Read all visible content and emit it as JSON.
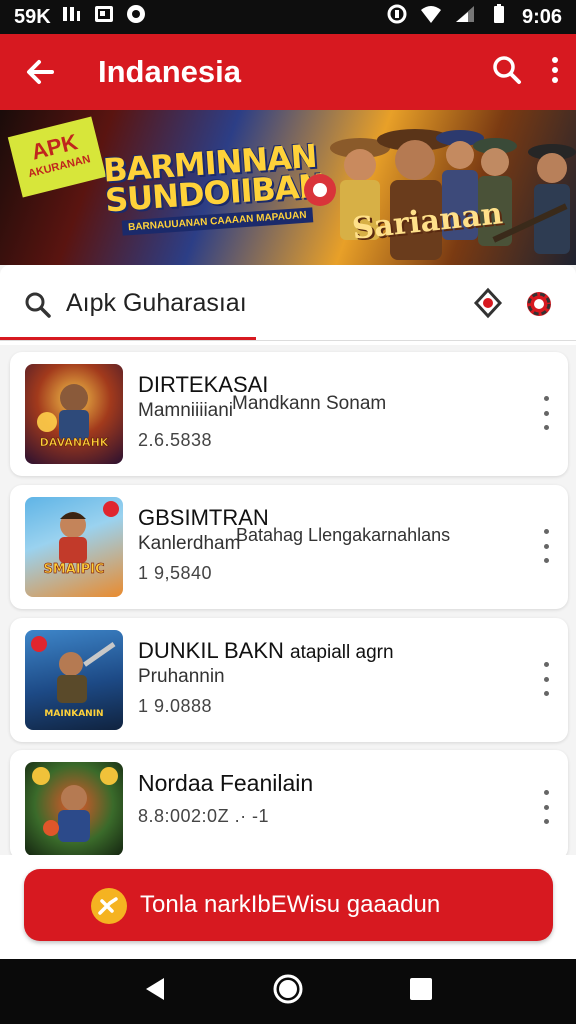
{
  "status_bar": {
    "left_text": "59K",
    "time": "9:06",
    "left_icons": [
      "signal-bars-icon",
      "gallery-icon",
      "message-icon"
    ],
    "right_icons": [
      "data-saver-icon",
      "wifi-icon",
      "cell-signal-icon",
      "battery-icon"
    ]
  },
  "app_bar": {
    "title": "Indanesia",
    "icons": [
      "back-arrow-icon",
      "search-icon",
      "more-vertical-icon"
    ]
  },
  "banner": {
    "tag_main": "APK",
    "tag_sub": "AKURANAN",
    "headline_line1": "BARMINNAN",
    "headline_line2": "SUNDOIIBAN",
    "tagline": "BARNAUUANAN CAAAAN MAPAUAN",
    "logo_text": "Sarianan"
  },
  "search": {
    "value": "Aıpk Guharasıaı",
    "icons": [
      "search-icon",
      "filter-chip-icon",
      "settings-chip-icon"
    ]
  },
  "games": [
    {
      "name": "DIRTEKASAI",
      "subtitle": "Mamniiiiani",
      "subtitle_extra": "Mandkann Sonam",
      "meta": "2.6.5838",
      "thumb_text": "DAVANAHK",
      "accent": "#e08a1c"
    },
    {
      "name": "GBSIMTRAN",
      "subtitle": "Kanlerdham",
      "subtitle_extra": "Batahag  Llengakarnahlans",
      "meta": "1 9,5840",
      "thumb_text": "SMAIPIC",
      "accent": "#3c7fd6"
    },
    {
      "name": "DUNKIL BAKN",
      "subtitle": "Pruhannin",
      "subtitle_extra": "atapiall agrn",
      "meta": "1 9.0888",
      "thumb_text": "MAINKANIN",
      "accent": "#2a5ca8"
    },
    {
      "name": "Nordaa Feanilain",
      "subtitle": "",
      "subtitle_extra": "",
      "meta": "8.8:002:0Z .· -1",
      "thumb_text": "",
      "accent": "#2d6b38"
    }
  ],
  "cta": {
    "label": "Tonla narkIbEWisu gaaadun",
    "icon": "bolt-icon"
  },
  "nav": {
    "icons": [
      "back-triangle-icon",
      "home-circle-icon",
      "recents-square-icon"
    ]
  },
  "colors": {
    "primary": "#d71920",
    "background": "#f4f4f4",
    "card": "#ffffff"
  }
}
